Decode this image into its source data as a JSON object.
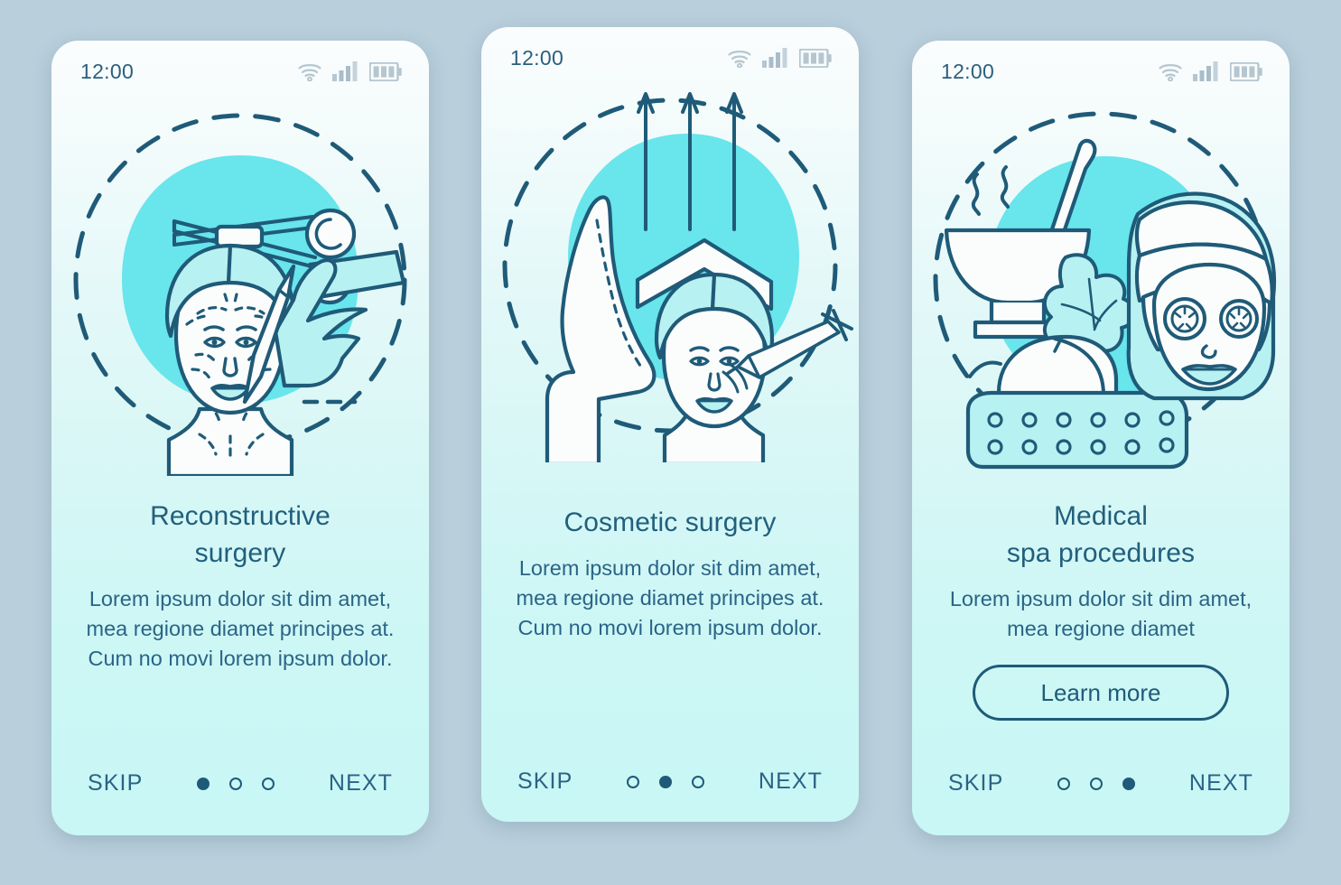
{
  "theme": {
    "page_background": "#b9cfdc",
    "card_top": "#fbfdfd",
    "card_bottom": "#c8f7f5",
    "accent_teal": "#69e5ec",
    "stroke_dark": "#1f5b78",
    "text_title": "#225f7d",
    "text_body": "#2a6486",
    "status_icon": "#b5c6d0",
    "fill_light": "#b8f1f2"
  },
  "screens": [
    {
      "id": "reconstructive-surgery",
      "statusbar": {
        "time": "12:00",
        "icons": [
          "wifi-icon",
          "cellular-signal-icon",
          "battery-icon"
        ]
      },
      "illustration": {
        "name": "reconstructive-surgery-illustration",
        "elements": [
          "surgical-scissors-icon",
          "marked-face-icon",
          "gloved-hand-with-scalpel-icon",
          "teal-blob",
          "dashed-circle"
        ]
      },
      "title": "Reconstructive\nsurgery",
      "title_lines": [
        "Reconstructive",
        "surgery"
      ],
      "description": "Lorem ipsum dolor sit dim amet, mea regione diamet principes at. Cum no movi lorem ipsum dolor.",
      "has_learn_more": false,
      "learn_more_label": "",
      "nav": {
        "skip_label": "SKIP",
        "next_label": "NEXT",
        "dot_count": 3,
        "active_dot": 1
      }
    },
    {
      "id": "cosmetic-surgery",
      "statusbar": {
        "time": "12:00",
        "icons": [
          "wifi-icon",
          "cellular-signal-icon",
          "battery-icon"
        ]
      },
      "illustration": {
        "name": "cosmetic-surgery-illustration",
        "elements": [
          "nose-profile-icon",
          "face-with-syringe-icon",
          "brow-lift-chevron-icon",
          "three-up-arrows-icon",
          "teal-blob",
          "dashed-circle"
        ]
      },
      "title": "Cosmetic surgery",
      "title_lines": [
        "Cosmetic surgery"
      ],
      "description": "Lorem ipsum dolor sit dim amet, mea regione diamet principes at. Cum no movi lorem ipsum dolor.",
      "has_learn_more": false,
      "learn_more_label": "",
      "nav": {
        "skip_label": "SKIP",
        "next_label": "NEXT",
        "dot_count": 3,
        "active_dot": 2
      }
    },
    {
      "id": "medical-spa-procedures",
      "statusbar": {
        "time": "12:00",
        "icons": [
          "wifi-icon",
          "cellular-signal-icon",
          "battery-icon"
        ]
      },
      "illustration": {
        "name": "medical-spa-illustration",
        "elements": [
          "mortar-and-pestle-icon",
          "steam-icon",
          "frangipani-flower-icon",
          "rolled-towels-icon",
          "massage-mat-icon",
          "woman-with-facemask-icon",
          "cucumber-slices-icon",
          "teal-blob",
          "dashed-circle"
        ]
      },
      "title": "Medical\nspa procedures",
      "title_lines": [
        "Medical",
        "spa procedures"
      ],
      "description": "Lorem ipsum dolor sit dim amet, mea regione diamet",
      "has_learn_more": true,
      "learn_more_label": "Learn more",
      "nav": {
        "skip_label": "SKIP",
        "next_label": "NEXT",
        "dot_count": 3,
        "active_dot": 3
      }
    }
  ]
}
